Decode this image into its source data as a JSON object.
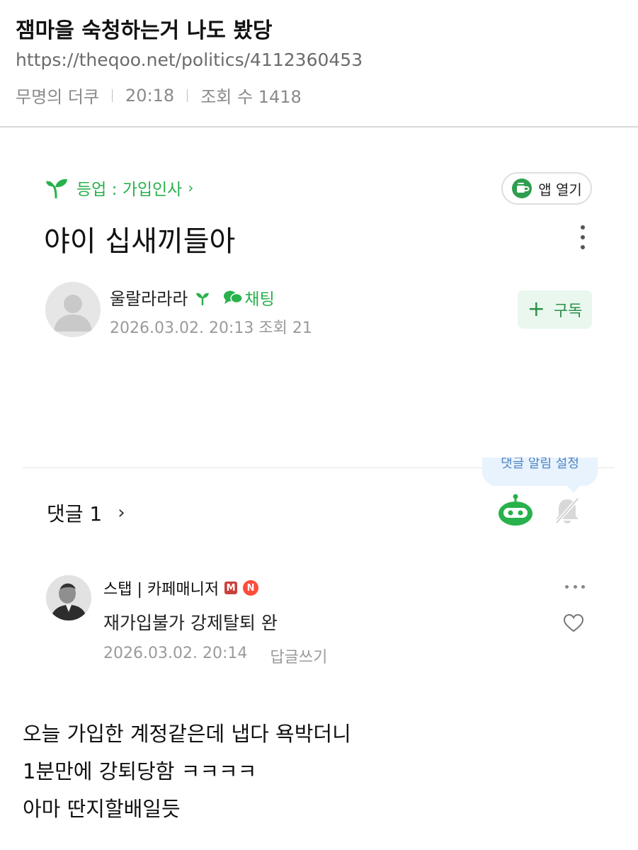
{
  "post": {
    "title": "잼마을 숙청하는거 나도 봤당",
    "url": "https://theqoo.net/politics/4112360453",
    "author": "무명의 더쿠",
    "time": "20:18",
    "views": "조회 수 1418"
  },
  "cafe": {
    "board_link": "등업 : 가입인사",
    "app_open_label": "앱 열기",
    "article_title": "야이 십새끼들아",
    "author_name": "울랄라라라",
    "chat_label": "채팅",
    "article_meta": "2026.03.02. 20:13 조회 21",
    "subscribe_label": "구독",
    "subscribe_plus": "+",
    "notify_tooltip": "댓글 알림 설정",
    "comments_header": "댓글 1",
    "comment": {
      "author": "스탭 | 카페매니저",
      "badge_m": "M",
      "badge_n": "N",
      "text": "재가입불가 강제탈퇴 완",
      "date": "2026.03.02. 20:14",
      "reply_label": "답글쓰기"
    }
  },
  "caption": {
    "line1": "오늘 가입한 계정같은데 냅다 욕박더니",
    "line2": "1분만에 강퇴당함 ㅋㅋㅋㅋ",
    "line3": "아마 딴지할배일듯"
  },
  "colors": {
    "accent_green": "#28b14c",
    "tooltip_blue": "#4b84c4",
    "meta_gray": "#9a9a9a"
  }
}
